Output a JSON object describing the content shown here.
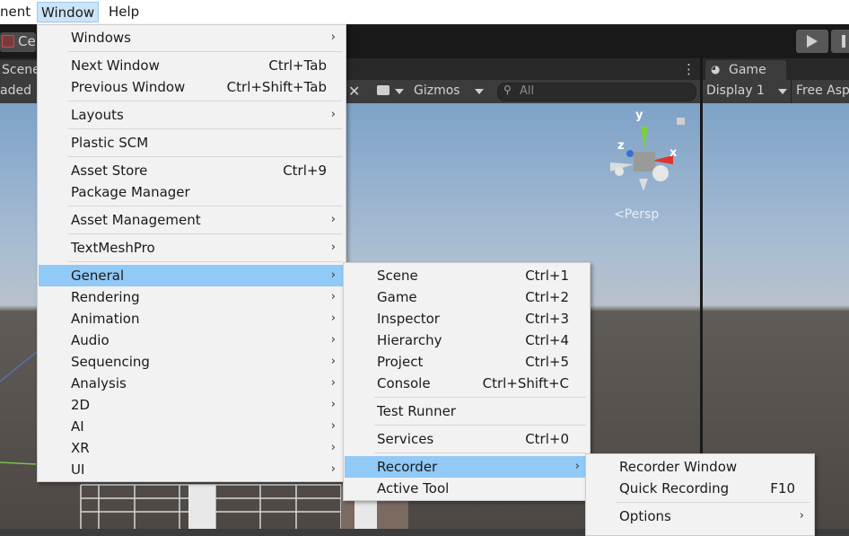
{
  "menubar": {
    "items": [
      "nent",
      "Window",
      "Help"
    ]
  },
  "toolbar": {
    "center_label": "Ce"
  },
  "scene": {
    "tab": "Scene",
    "shaded_label": "aded",
    "gizmos": "Gizmos",
    "search_placeholder": "All",
    "gizmo_axes": {
      "y": "y",
      "z": "z",
      "x": "x"
    },
    "persp": "Persp"
  },
  "game": {
    "tab": "Game",
    "display": "Display 1",
    "aspect": "Free Asp"
  },
  "window_menu": {
    "items": [
      {
        "label": "Windows",
        "shortcut": "",
        "submenu": true
      },
      {
        "label": "Next Window",
        "shortcut": "Ctrl+Tab",
        "submenu": false
      },
      {
        "label": "Previous Window",
        "shortcut": "Ctrl+Shift+Tab",
        "submenu": false
      },
      {
        "label": "Layouts",
        "shortcut": "",
        "submenu": true
      },
      {
        "label": "Plastic SCM",
        "shortcut": "",
        "submenu": false
      },
      {
        "label": "Asset Store",
        "shortcut": "Ctrl+9",
        "submenu": false
      },
      {
        "label": "Package Manager",
        "shortcut": "",
        "submenu": false
      },
      {
        "label": "Asset Management",
        "shortcut": "",
        "submenu": true
      },
      {
        "label": "TextMeshPro",
        "shortcut": "",
        "submenu": true
      },
      {
        "label": "General",
        "shortcut": "",
        "submenu": true,
        "highlighted": true
      },
      {
        "label": "Rendering",
        "shortcut": "",
        "submenu": true
      },
      {
        "label": "Animation",
        "shortcut": "",
        "submenu": true
      },
      {
        "label": "Audio",
        "shortcut": "",
        "submenu": true
      },
      {
        "label": "Sequencing",
        "shortcut": "",
        "submenu": true
      },
      {
        "label": "Analysis",
        "shortcut": "",
        "submenu": true
      },
      {
        "label": "2D",
        "shortcut": "",
        "submenu": true
      },
      {
        "label": "AI",
        "shortcut": "",
        "submenu": true
      },
      {
        "label": "XR",
        "shortcut": "",
        "submenu": true
      },
      {
        "label": "UI",
        "shortcut": "",
        "submenu": true
      }
    ]
  },
  "general_menu": {
    "items": [
      {
        "label": "Scene",
        "shortcut": "Ctrl+1",
        "submenu": false
      },
      {
        "label": "Game",
        "shortcut": "Ctrl+2",
        "submenu": false
      },
      {
        "label": "Inspector",
        "shortcut": "Ctrl+3",
        "submenu": false
      },
      {
        "label": "Hierarchy",
        "shortcut": "Ctrl+4",
        "submenu": false
      },
      {
        "label": "Project",
        "shortcut": "Ctrl+5",
        "submenu": false
      },
      {
        "label": "Console",
        "shortcut": "Ctrl+Shift+C",
        "submenu": false
      },
      {
        "label": "Test Runner",
        "shortcut": "",
        "submenu": false
      },
      {
        "label": "Services",
        "shortcut": "Ctrl+0",
        "submenu": false
      },
      {
        "label": "Recorder",
        "shortcut": "",
        "submenu": true,
        "highlighted": true
      },
      {
        "label": "Active Tool",
        "shortcut": "",
        "submenu": false
      }
    ]
  },
  "recorder_menu": {
    "items": [
      {
        "label": "Recorder Window",
        "shortcut": "",
        "submenu": false
      },
      {
        "label": "Quick Recording",
        "shortcut": "F10",
        "submenu": false
      },
      {
        "label": "Options",
        "shortcut": "",
        "submenu": true
      }
    ]
  },
  "colors": {
    "highlight": "#91c9f7",
    "menu_bg": "#f2f2f2",
    "editor_dark": "#191919"
  }
}
